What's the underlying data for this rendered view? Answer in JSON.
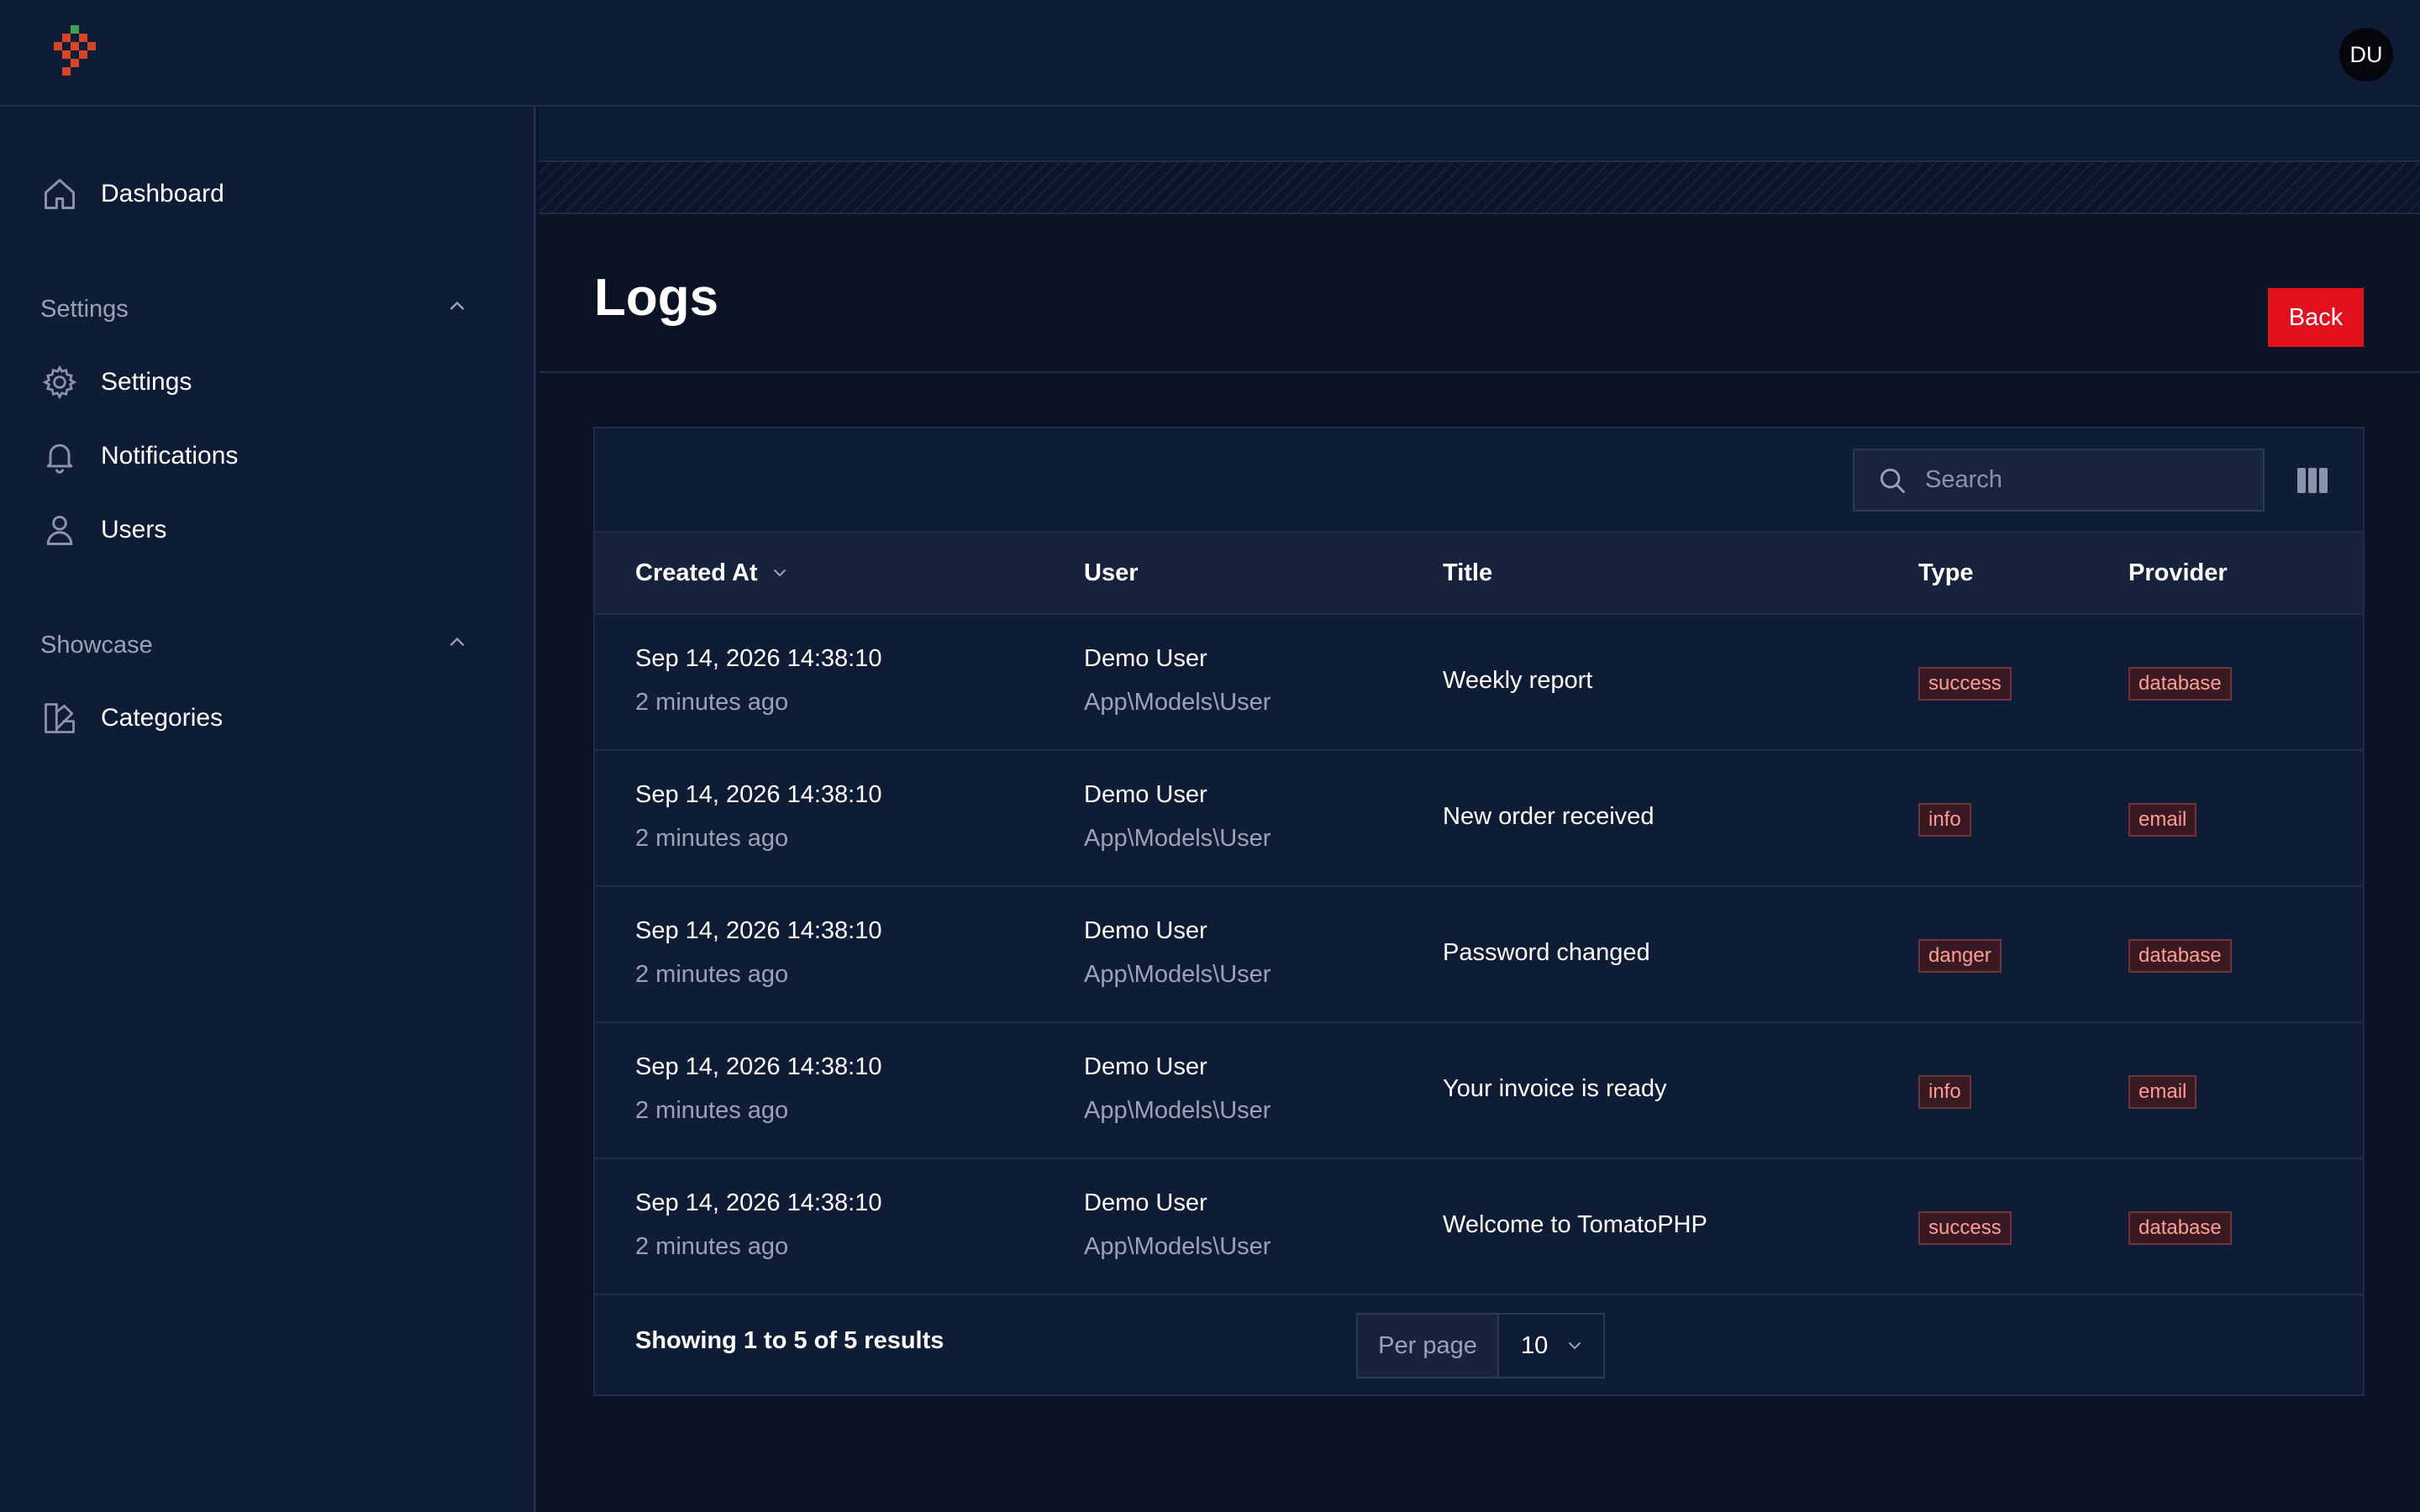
{
  "user": {
    "initials": "DU"
  },
  "sidebar": {
    "dashboard": "Dashboard",
    "groups": [
      {
        "label": "Settings",
        "items": [
          "Settings",
          "Notifications",
          "Users"
        ]
      },
      {
        "label": "Showcase",
        "items": [
          "Categories"
        ]
      }
    ]
  },
  "page": {
    "title": "Logs",
    "back_label": "Back"
  },
  "table": {
    "search_placeholder": "Search",
    "columns": [
      "Created At",
      "User",
      "Title",
      "Type",
      "Provider"
    ],
    "rows": [
      {
        "created": "Sep 14, 2026 14:38:10",
        "ago": "2 minutes ago",
        "user": "Demo User",
        "model": "App\\Models\\User",
        "title": "Weekly report",
        "type": "success",
        "provider": "database"
      },
      {
        "created": "Sep 14, 2026 14:38:10",
        "ago": "2 minutes ago",
        "user": "Demo User",
        "model": "App\\Models\\User",
        "title": "New order received",
        "type": "info",
        "provider": "email"
      },
      {
        "created": "Sep 14, 2026 14:38:10",
        "ago": "2 minutes ago",
        "user": "Demo User",
        "model": "App\\Models\\User",
        "title": "Password changed",
        "type": "danger",
        "provider": "database"
      },
      {
        "created": "Sep 14, 2026 14:38:10",
        "ago": "2 minutes ago",
        "user": "Demo User",
        "model": "App\\Models\\User",
        "title": "Your invoice is ready",
        "type": "info",
        "provider": "email"
      },
      {
        "created": "Sep 14, 2026 14:38:10",
        "ago": "2 minutes ago",
        "user": "Demo User",
        "model": "App\\Models\\User",
        "title": "Welcome to TomatoPHP",
        "type": "success",
        "provider": "database"
      }
    ],
    "summary": "Showing 1 to 5 of 5 results",
    "per_page_label": "Per page",
    "per_page_value": "10"
  },
  "colors": {
    "accent": "#e3101e",
    "background": "#0a1226",
    "panel": "#0f1c36"
  },
  "icons": [
    "logo-icon",
    "home-icon",
    "chevron-up-icon",
    "gear-icon",
    "bell-icon",
    "user-icon",
    "categories-icon",
    "search-icon",
    "columns-icon",
    "chevron-down-icon"
  ]
}
